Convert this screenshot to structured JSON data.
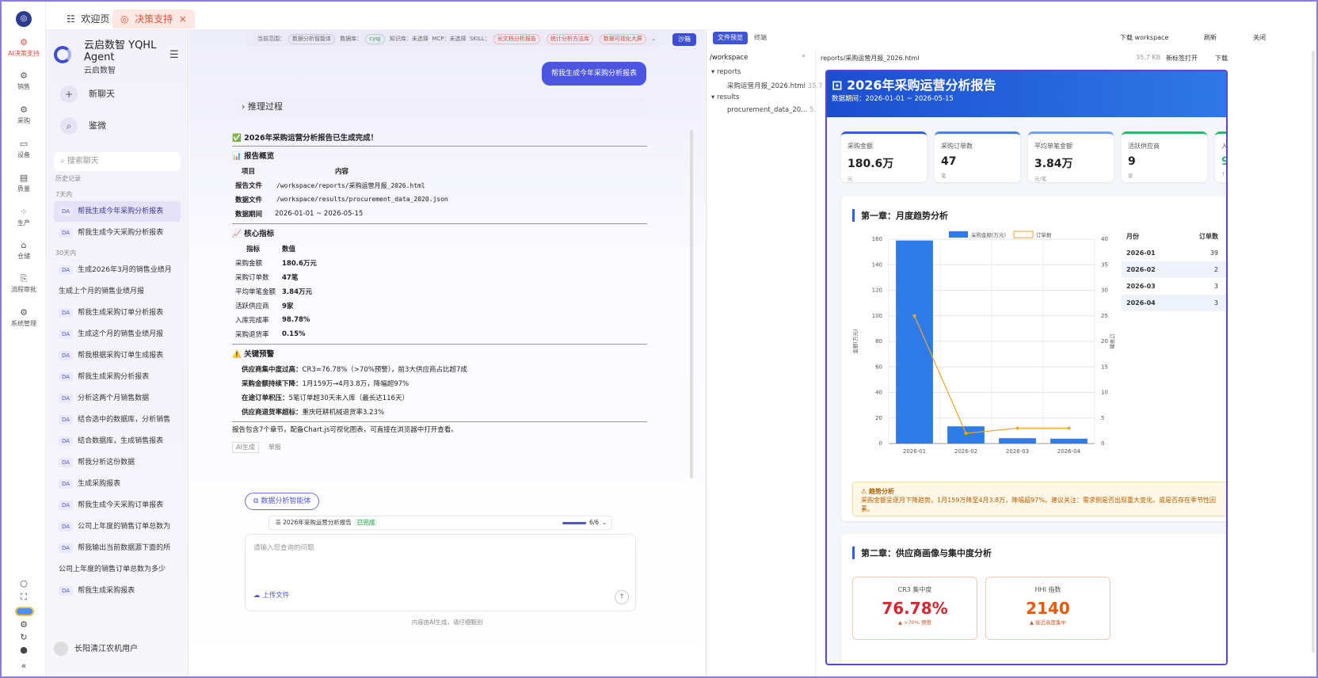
{
  "rail": {
    "items": [
      {
        "label": "AI决策支持",
        "icon": "ai-icon"
      },
      {
        "label": "销售",
        "icon": "sales-icon"
      },
      {
        "label": "采购",
        "icon": "purchase-icon"
      },
      {
        "label": "设备",
        "icon": "device-icon"
      },
      {
        "label": "质量",
        "icon": "quality-icon"
      },
      {
        "label": "生产",
        "icon": "production-icon"
      },
      {
        "label": "仓储",
        "icon": "warehouse-icon"
      },
      {
        "label": "流程审批",
        "icon": "approval-icon"
      },
      {
        "label": "系统管理",
        "icon": "settings-icon"
      }
    ]
  },
  "tabs": [
    {
      "label": "欢迎页"
    },
    {
      "label": "决策支持"
    }
  ],
  "sidebar": {
    "brand_line1": "云启数智 YQHL",
    "brand_line2": "Agent",
    "brand_sub": "云启数智",
    "new_chat": "新聊天",
    "mirror": "鉴微",
    "search_placeholder": "搜索聊天",
    "history_label": "历史记录",
    "group_7": "7天内",
    "group_30": "30天内",
    "hist7": [
      {
        "tag": "DA",
        "text": "帮我生成今年采购分析报表"
      },
      {
        "tag": "DA",
        "text": "帮我生成今天采购分析报表"
      }
    ],
    "hist30": [
      {
        "tag": "DA",
        "text": "生成2026年3月的销售业绩月"
      },
      {
        "tag": "",
        "text": "生成上个月的销售业绩月报"
      },
      {
        "tag": "DA",
        "text": "帮我生成采购订单分析报表"
      },
      {
        "tag": "DA",
        "text": "生成这个月的销售业绩月报"
      },
      {
        "tag": "DA",
        "text": "帮我根据采购订单生成报表"
      },
      {
        "tag": "DA",
        "text": "帮我生成采购分析报表"
      },
      {
        "tag": "DA",
        "text": "分析这两个月销售数据"
      },
      {
        "tag": "DA",
        "text": "结合选中的数据库，分析销售"
      },
      {
        "tag": "DA",
        "text": "结合数据库，生成销售报表"
      },
      {
        "tag": "DA",
        "text": "帮我分析这份数据"
      },
      {
        "tag": "DA",
        "text": "生成采购报表"
      },
      {
        "tag": "DA",
        "text": "帮我生成今天采购订单报表"
      },
      {
        "tag": "DA",
        "text": "公司上年度的销售订单总数为"
      },
      {
        "tag": "DA",
        "text": "帮我输出当前数据源下面的所"
      },
      {
        "tag": "",
        "text": "公司上年度的销售订单总数为多少"
      },
      {
        "tag": "DA",
        "text": "帮我生成采购报表"
      }
    ],
    "user": "长阳清江农机用户"
  },
  "chat": {
    "scope_label": "当前范围：",
    "agent_chip": "数据分析智能体",
    "db_label": "数据库：",
    "db_chip": "cyqj",
    "kb_label": "知识库：",
    "kb_val": "未选择",
    "mcp_label": "MCP：",
    "mcp_val": "未选择",
    "skill_label": "SKILL：",
    "skills": [
      "长文档分析报告",
      "统计分析方法库",
      "数据可视化大屏"
    ],
    "sandbox": "沙箱",
    "user_msg": "帮我生成今年采购分析报表",
    "reasoning": "推理过程",
    "done": "✅ 2026年采购运营分析报告已生成完成！",
    "overview_h": "📊 报告概览",
    "col_item": "项目",
    "col_content": "内容",
    "ov": [
      {
        "k": "报告文件",
        "v": "/workspace/reports/采购运营月报_2026.html"
      },
      {
        "k": "数据文件",
        "v": "/workspace/results/procurement_data_2020.json"
      },
      {
        "k": "数据期间",
        "v": "2026-01-01 ~ 2026-05-15"
      }
    ],
    "metrics_h": "📈 核心指标",
    "col_metric": "指标",
    "col_value": "数值",
    "metrics": [
      {
        "k": "采购金额",
        "v": "180.6万元"
      },
      {
        "k": "采购订单数",
        "v": "47笔"
      },
      {
        "k": "平均单笔金额",
        "v": "3.84万元"
      },
      {
        "k": "活跃供应商",
        "v": "9家"
      },
      {
        "k": "入库完成率",
        "v": "98.78%"
      },
      {
        "k": "采购退货率",
        "v": "0.15%"
      }
    ],
    "warn_h": "⚠️ 关键预警",
    "warns": [
      {
        "k": "供应商集中度过高：",
        "v": "CR3=76.78%（>70%预警），前3大供应商占比超7成"
      },
      {
        "k": "采购金额持续下降：",
        "v": "1月159万→4月3.8万，降幅超97%"
      },
      {
        "k": "在途订单积压：",
        "v": "5笔订单超30天未入库（最长达116天）"
      },
      {
        "k": "供应商退货率超标：",
        "v": "重庆旺耕机械退货率3.23%"
      }
    ],
    "summary": "报告包含7个章节，配备Chart.js可视化图表，可直接在浏览器中打开查看。",
    "tag_ai": "AI生成",
    "tag_single": "单报",
    "agent_btn": "数据分析智能体",
    "progress_label": "2026年采购运营分析报告",
    "progress_status": "已完成",
    "progress_count": "6/6",
    "progress_fraction": 1.0,
    "input_placeholder": "请输入您查询的问题",
    "upload": "上传文件",
    "disclaimer": "内容由AI生成，请仔细甄别"
  },
  "right": {
    "tab_preview": "文件预览",
    "tab_terminal": "终端",
    "download_ws": "下载 workspace",
    "refresh": "刷新",
    "close": "关闭",
    "tree_root": "/workspace",
    "tree": [
      {
        "name": "reports",
        "type": "folder"
      },
      {
        "name": "采购运营月报_2026.html",
        "size": "35.7",
        "type": "file"
      },
      {
        "name": "results",
        "type": "folder"
      },
      {
        "name": "procurement_data_20...",
        "size": "5.",
        "type": "file"
      }
    ],
    "file_path": "reports/采购运营月报_2026.html",
    "file_size": "35.7 KB",
    "open_tab": "新标签打开",
    "download": "下载",
    "report": {
      "title": "2026年采购运营分析报告",
      "period": "数据期间：2026-01-01 ~ 2026-05-15",
      "kpis": [
        {
          "label": "采购金额",
          "value": "180.6万",
          "unit": "元"
        },
        {
          "label": "采购订单数",
          "value": "47",
          "unit": "笔"
        },
        {
          "label": "平均单笔金额",
          "value": "3.84万",
          "unit": "元/笔"
        },
        {
          "label": "活跃供应商",
          "value": "9",
          "unit": "家"
        },
        {
          "label": "入",
          "value": "9",
          "unit": "↑"
        }
      ],
      "ch1": "第一章：月度趋势分析",
      "ch2": "第二章：供应商画像与集中度分析",
      "month_table": {
        "h1": "月份",
        "h2": "订单数",
        "rows": [
          {
            "m": "2026-01",
            "n": "39"
          },
          {
            "m": "2026-02",
            "n": "2"
          },
          {
            "m": "2026-03",
            "n": "3"
          },
          {
            "m": "2026-04",
            "n": "3"
          }
        ]
      },
      "alert_title": "趋势分析",
      "alert_text": "采购金额呈逐月下降趋势，1月159万降至4月3.8万，降幅超97%。建议关注：需求侧是否出现重大变化，或是否存在季节性因素。",
      "cr3_label": "CR3 集中度",
      "cr3_value": "76.78%",
      "cr3_note": "▲ >70% 预警",
      "hhi_label": "HHI 指数",
      "hhi_value": "2140",
      "hhi_note": "▲ 接近高度集中"
    }
  },
  "chart_data": {
    "type": "bar",
    "categories": [
      "2026-01",
      "2026-02",
      "2026-03",
      "2026-04"
    ],
    "series": [
      {
        "name": "采购金额(万元)",
        "type": "bar",
        "values": [
          159,
          13.5,
          4.2,
          3.8
        ],
        "color": "#2f7be8"
      },
      {
        "name": "订单数",
        "type": "line",
        "values": [
          25,
          2,
          3,
          3
        ],
        "color": "#f5a623"
      }
    ],
    "ylabel": "金额(万元)",
    "y2label": "订单数",
    "ylim": [
      0,
      160
    ],
    "y2lim": [
      0,
      40
    ],
    "yticks": [
      0,
      20,
      40,
      60,
      80,
      100,
      120,
      140,
      160
    ],
    "y2ticks": [
      0,
      5,
      10,
      15,
      20,
      25,
      30,
      35,
      40
    ],
    "grid": true,
    "legend": "top"
  }
}
